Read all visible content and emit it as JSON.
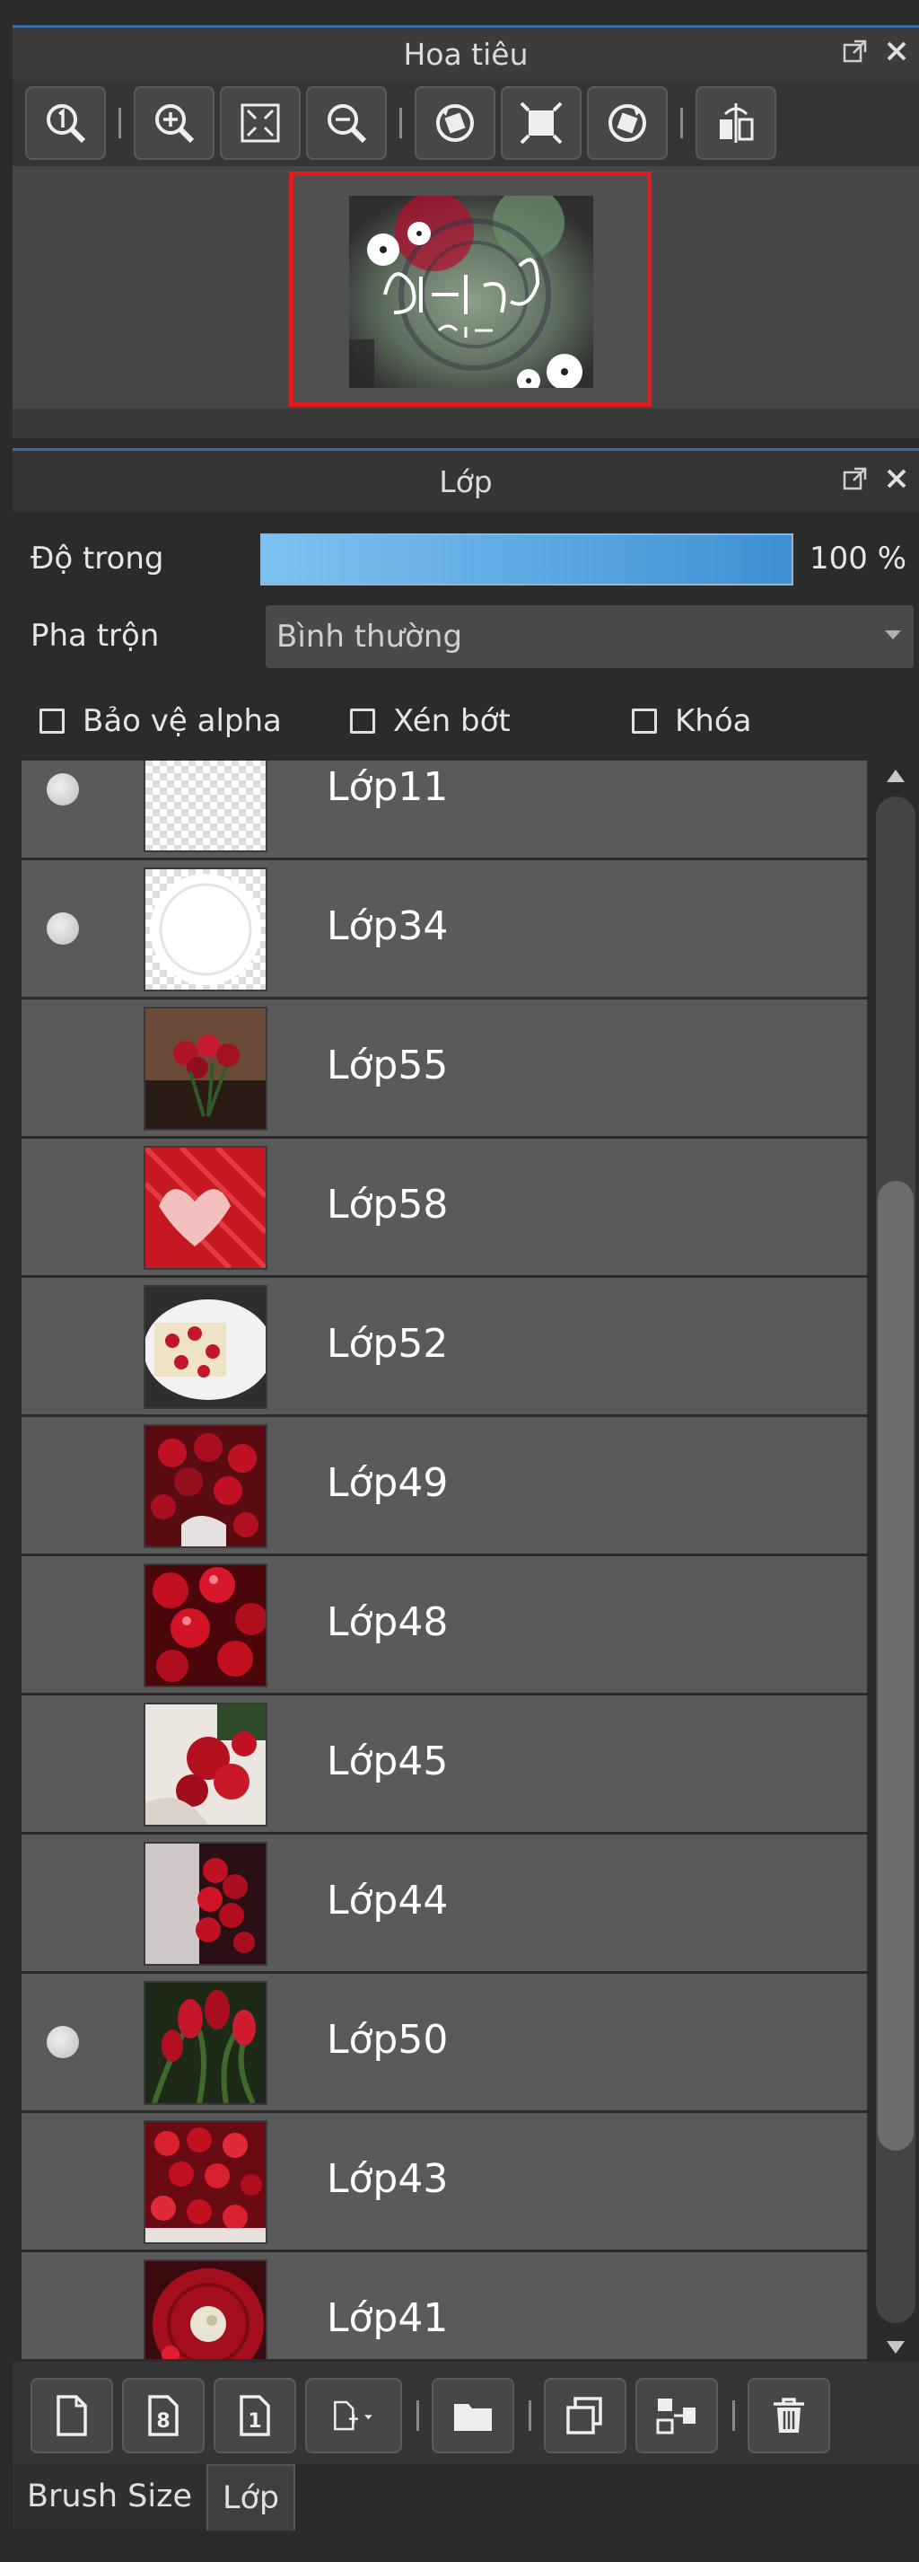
{
  "navigator": {
    "title": "Hoa tiêu",
    "toolbar": [
      "zoom-actual-size",
      "zoom-in",
      "fit-to-window",
      "zoom-out",
      "rotate-left",
      "fullscreen",
      "rotate-right",
      "flip-horizontal"
    ]
  },
  "layers_panel": {
    "title": "Lớp",
    "opacity_label": "Độ trong",
    "opacity_value": "100 %",
    "opacity_fraction": 1.0,
    "blend_label": "Pha trộn",
    "blend_value": "Bình thường",
    "checkboxes": {
      "protect_alpha": "Bảo vệ alpha",
      "clipping": "Xén bớt",
      "lock": "Khóa"
    },
    "layers": [
      {
        "name": "Lớp11",
        "visible": true
      },
      {
        "name": "Lớp34",
        "visible": true
      },
      {
        "name": "Lớp55",
        "visible": false
      },
      {
        "name": "Lớp58",
        "visible": false
      },
      {
        "name": "Lớp52",
        "visible": false
      },
      {
        "name": "Lớp49",
        "visible": false
      },
      {
        "name": "Lớp48",
        "visible": false
      },
      {
        "name": "Lớp45",
        "visible": false
      },
      {
        "name": "Lớp44",
        "visible": false
      },
      {
        "name": "Lớp50",
        "visible": true
      },
      {
        "name": "Lớp43",
        "visible": false
      },
      {
        "name": "Lớp41",
        "visible": false
      }
    ]
  },
  "bottom_tabs": {
    "brush_size": "Brush Size",
    "layer": "Lớp"
  },
  "colors": {
    "accent": "#3b6ea0",
    "navigator_frame": "#e01c1c",
    "opacity_bar": "#5aa9e6"
  }
}
